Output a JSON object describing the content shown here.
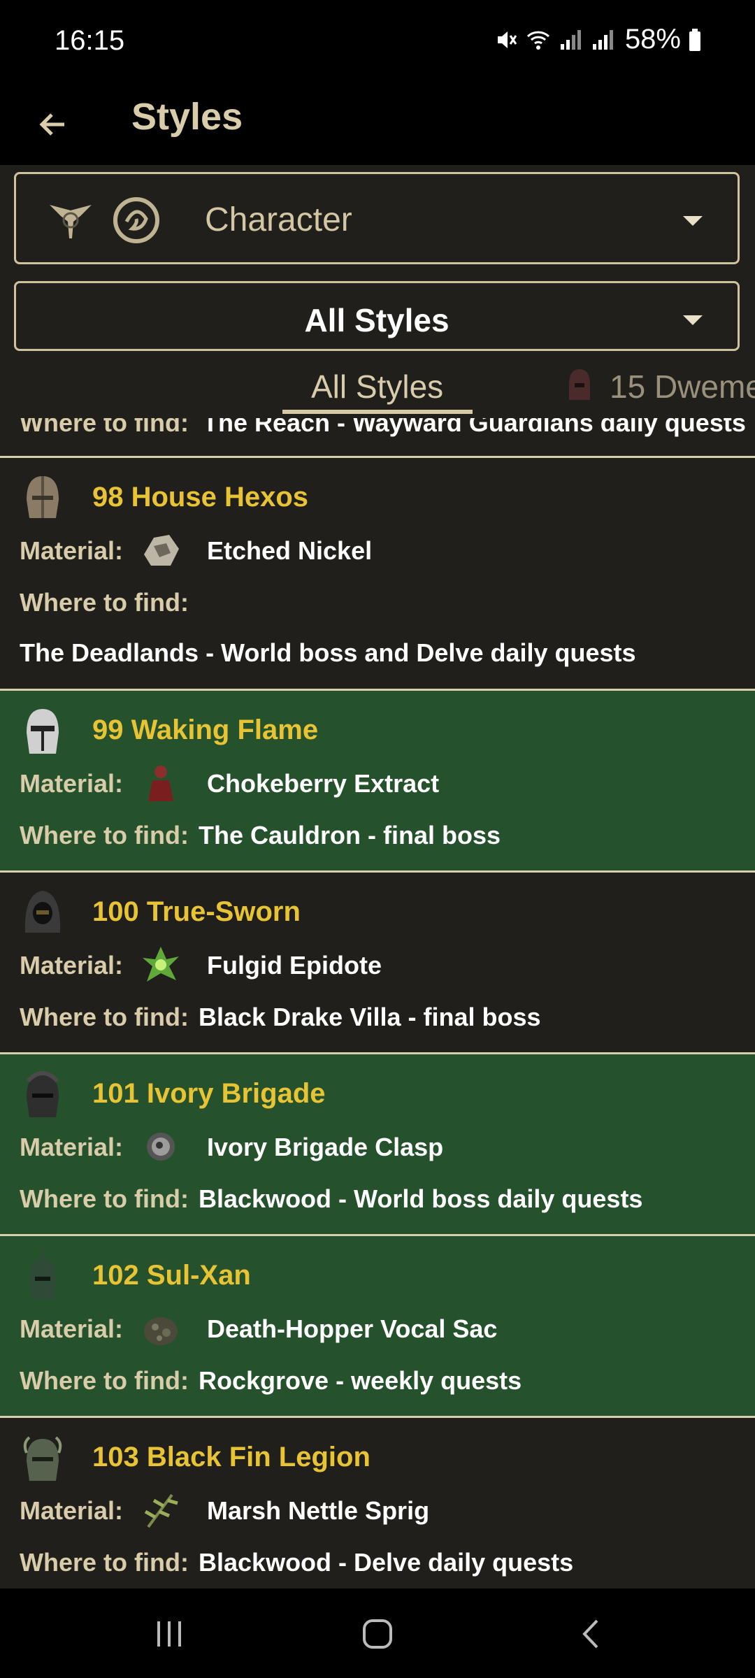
{
  "status": {
    "time": "16:15",
    "battery": "58%"
  },
  "appbar": {
    "title": "Styles"
  },
  "filters": {
    "category_label": "Character",
    "styles_label": "All Styles"
  },
  "tabs": [
    {
      "label": "All Styles"
    },
    {
      "label": "15 Dweme"
    }
  ],
  "labels": {
    "material": "Material:",
    "where": "Where to find:"
  },
  "partial_row": {
    "where": "The Reach - Wayward Guardians daily quests"
  },
  "styles": [
    {
      "title": "98 House Hexos",
      "material": "Etched Nickel",
      "where": "The Deadlands - World boss and Delve daily quests",
      "color": "#201f1c"
    },
    {
      "title": "99 Waking Flame",
      "material": "Chokeberry Extract",
      "where": "The Cauldron - final boss",
      "color": "#25512c"
    },
    {
      "title": "100 True-Sworn",
      "material": "Fulgid Epidote",
      "where": "Black Drake Villa - final boss",
      "color": "#201f1c"
    },
    {
      "title": "101 Ivory Brigade",
      "material": "Ivory Brigade Clasp",
      "where": "Blackwood - World boss daily quests",
      "color": "#25512c"
    },
    {
      "title": "102 Sul-Xan",
      "material": "Death-Hopper Vocal Sac",
      "where": "Rockgrove - weekly quests",
      "color": "#25512c"
    },
    {
      "title": "103 Black Fin Legion",
      "material": "Marsh Nettle Sprig",
      "where": "Blackwood - Delve daily quests",
      "color": "#201f1c"
    }
  ]
}
